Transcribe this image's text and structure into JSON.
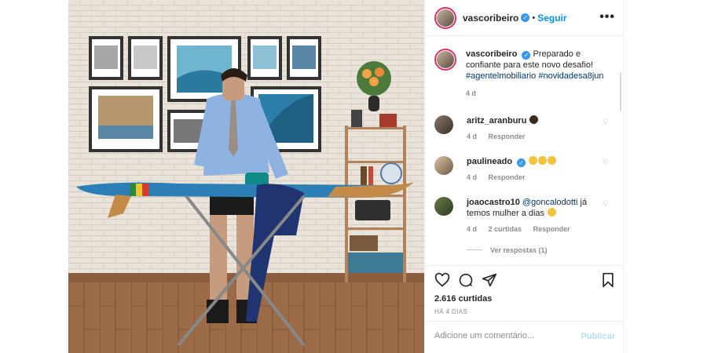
{
  "post": {
    "username": "vascoribeiro",
    "separator": "•",
    "follow_label": "Seguir",
    "more_label": "•••",
    "verified_icon": "verified-icon",
    "caption": {
      "text": "Preparado e confiante para este novo desafio!",
      "hashtags": "#agentelmobiliario #novidadesa8jun",
      "time": "4 d"
    }
  },
  "comments": [
    {
      "username": "aritz_aranburu",
      "text": "",
      "emoji": "couple-emoji",
      "time": "4 d",
      "reply_label": "Responder"
    },
    {
      "username": "paulineado",
      "verified": true,
      "text": "",
      "emoji": "laughing-emoji x3",
      "time": "4 d",
      "reply_label": "Responder"
    },
    {
      "username": "joaocastro10",
      "mention": "@goncalodotti",
      "text": "já temos mulher a dias",
      "emoji": "laughing-emoji",
      "time": "4 d",
      "likes_label": "2 curtidas",
      "reply_label": "Responder",
      "view_replies": "Ver respostas (1)"
    }
  ],
  "actions": {
    "likes": "2.616 curtidas",
    "posted_ago": "HÁ 4 DIAS",
    "icons": [
      "heart-icon",
      "comment-icon",
      "share-icon",
      "bookmark-icon"
    ]
  },
  "add_comment": {
    "placeholder": "Adicione um comentário...",
    "publish_label": "Publicar"
  },
  "colors": {
    "accent": "#0095f6",
    "verified": "#3897f0",
    "publish_disabled": "#b2dffc",
    "muted": "#8e8e8e"
  }
}
